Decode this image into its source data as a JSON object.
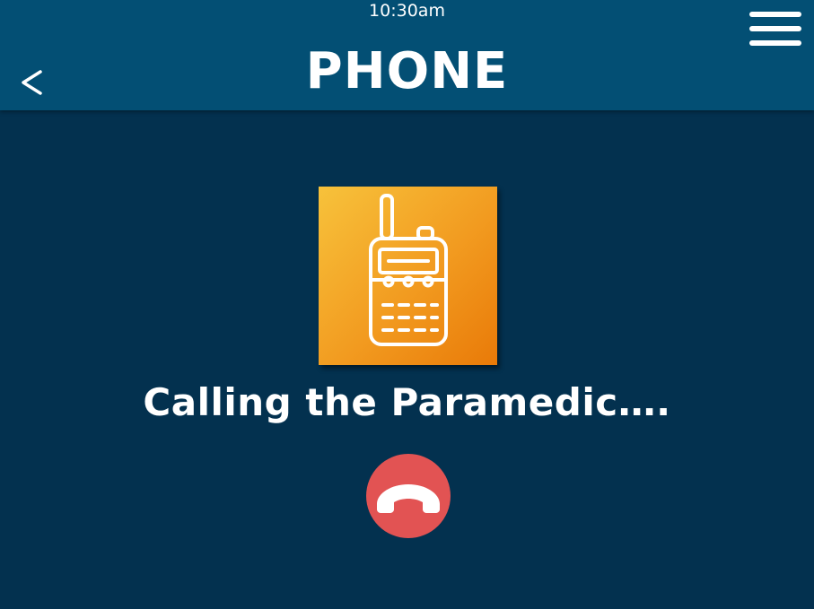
{
  "status_bar": {
    "time": "10:30am"
  },
  "header": {
    "back_label": "<",
    "title": "PHONE",
    "menu_icon": "hamburger-menu-icon"
  },
  "contact": {
    "icon": "walkie-talkie-icon",
    "tile_colors": [
      "#f7c23b",
      "#e97a08"
    ]
  },
  "call": {
    "status_text": "Calling the Paramedic….",
    "end_call_icon": "phone-hangup-icon",
    "end_call_color": "#e25353"
  },
  "colors": {
    "header_bg": "#034f74",
    "screen_bg": "#03314f",
    "text": "#ffffff"
  }
}
